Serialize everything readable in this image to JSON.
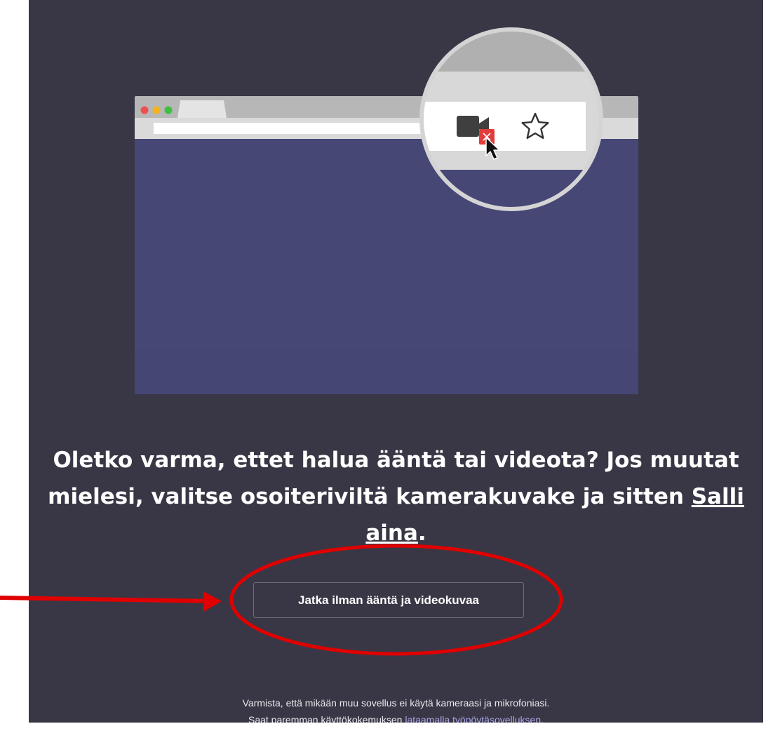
{
  "illustration": {
    "browser_window": "browser-window",
    "camera_icon": "camera-icon",
    "blocked_icon": "camera-blocked-icon",
    "cursor_icon": "mouse-pointer-icon",
    "star_icon": "star-icon",
    "colors": {
      "background": "#393745",
      "browser_body": "#464775",
      "toolbar": "#d8d8d8",
      "blocked": "#e23d3d"
    }
  },
  "message": {
    "part1": "Oletko varma, ettet halua ääntä tai videota? Jos muutat mielesi, valitse osoiteriviltä kamerakuvake ja sitten ",
    "link": "Salli aina",
    "end": "."
  },
  "continue_button": {
    "label": "Jatka ilman ääntä ja videokuvaa"
  },
  "footer": {
    "line1": "Varmista, että mikään muu sovellus ei käytä kameraasi ja mikrofoniasi.",
    "line2_prefix": "Saat paremman käyttökokemuksen ",
    "line2_link": "lataamalla työpöytäsovelluksen",
    "line2_suffix": "."
  },
  "annotation": {
    "color": "#e00000"
  }
}
